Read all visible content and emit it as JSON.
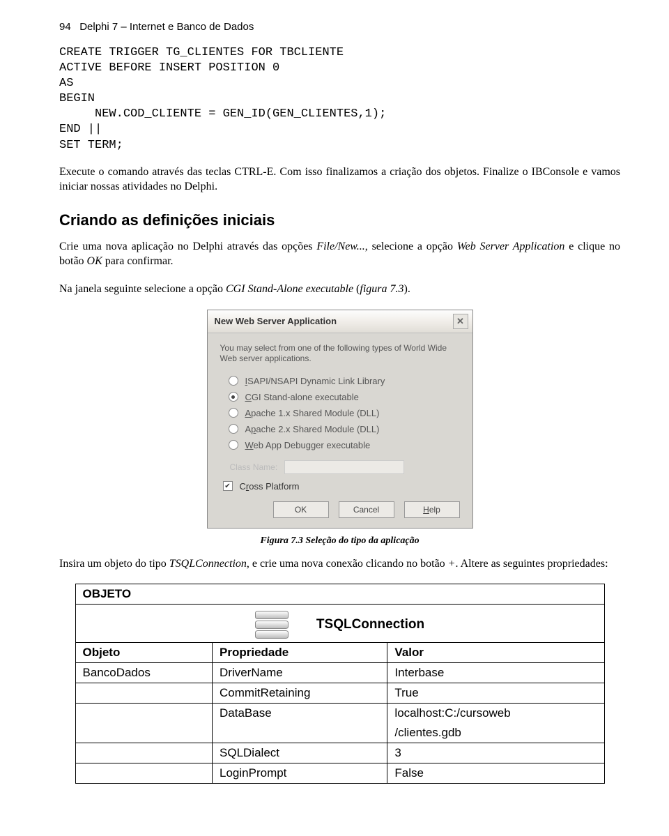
{
  "header": {
    "pageNumber": "94",
    "bookTitle": "Delphi 7 – Internet e Banco de Dados"
  },
  "code": "CREATE TRIGGER TG_CLIENTES FOR TBCLIENTE\nACTIVE BEFORE INSERT POSITION 0\nAS\nBEGIN\n     NEW.COD_CLIENTE = GEN_ID(GEN_CLIENTES,1);\nEND ||\nSET TERM;",
  "paragraphs": {
    "p1": "Execute o comando através das teclas CTRL-E. Com isso finalizamos a criação dos objetos. Finalize o IBConsole e vamos iniciar nossas atividades no Delphi.",
    "sectionTitle": "Criando as definições iniciais",
    "p2a": "Crie uma nova aplicação no Delphi através das opções ",
    "p2b": "File/New...",
    "p2c": ", selecione a opção ",
    "p2d": "Web Server Application",
    "p2e": " e clique no botão ",
    "p2f": "OK",
    "p2g": " para confirmar.",
    "p3a": "Na janela seguinte selecione a opção ",
    "p3b": "CGI Stand-Alone executable",
    "p3c": " (",
    "p3d": "figura 7.3",
    "p3e": ").",
    "caption": "Figura 7.3  Seleção do tipo da aplicação",
    "p4a": "Insira um objeto do tipo ",
    "p4b": "TSQLConnection",
    "p4c": ", e crie uma nova conexão clicando no botão ",
    "p4d": "+",
    "p4e": ". Altere as seguintes propriedades:"
  },
  "dialog": {
    "title": "New Web Server Application",
    "intro": "You may select from one of the following types of World Wide Web server applications.",
    "options": [
      {
        "label": "ISAPI/NSAPI Dynamic Link Library",
        "selected": false,
        "accel": "I"
      },
      {
        "label": "CGI Stand-alone executable",
        "selected": true,
        "accel": "C"
      },
      {
        "label": "Apache 1.x Shared Module (DLL)",
        "selected": false,
        "accel": "A"
      },
      {
        "label": "Apache 2.x Shared Module (DLL)",
        "selected": false,
        "accel": "p"
      },
      {
        "label": "Web App Debugger executable",
        "selected": false,
        "accel": "W"
      }
    ],
    "classLabel": "Class Name:",
    "crossPlatform": {
      "label": "Cross Platform",
      "checked": true,
      "accel": "r"
    },
    "buttons": {
      "ok": "OK",
      "cancel": "Cancel",
      "help": "Help"
    }
  },
  "table": {
    "header": "OBJETO",
    "iconLabel": "TSQLConnection",
    "cols": [
      "Objeto",
      "Propriedade",
      "Valor"
    ],
    "rows": [
      [
        "BancoDados",
        "DriverName",
        "Interbase"
      ],
      [
        "",
        "CommitRetaining",
        "True"
      ],
      [
        "",
        "DataBase",
        "localhost:C:/cursoweb/clientes.gdb"
      ],
      [
        "",
        "SQLDialect",
        "3"
      ],
      [
        "",
        "LoginPrompt",
        "False"
      ]
    ]
  }
}
